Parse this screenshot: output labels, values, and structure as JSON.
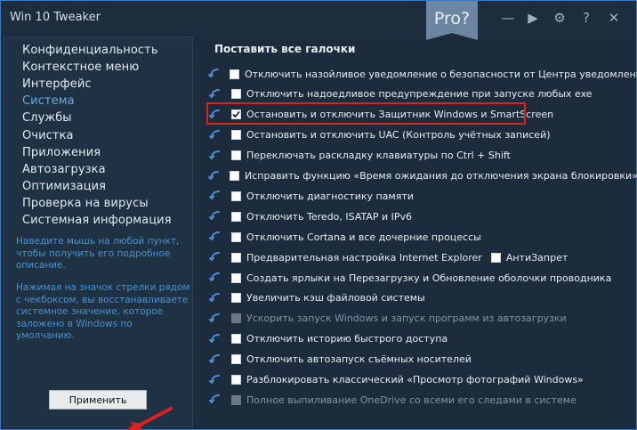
{
  "window": {
    "title": "Win 10 Tweaker",
    "pro_label": "Pro?",
    "controls": [
      "minimize-icon",
      "play-icon",
      "gear-icon",
      "help-icon",
      "close-icon"
    ],
    "control_glyphs": [
      "—",
      "▶",
      "⚙",
      "?",
      "✕"
    ]
  },
  "sidebar": {
    "items": [
      {
        "label": "Конфиденциальность",
        "active": false
      },
      {
        "label": "Контекстное меню",
        "active": false
      },
      {
        "label": "Интерфейс",
        "active": false
      },
      {
        "label": "Система",
        "active": true
      },
      {
        "label": "Службы",
        "active": false
      },
      {
        "label": "Очистка",
        "active": false
      },
      {
        "label": "Приложения",
        "active": false
      },
      {
        "label": "Автозагрузка",
        "active": false
      },
      {
        "label": "Оптимизация",
        "active": false
      },
      {
        "label": "Проверка на вирусы",
        "active": false
      },
      {
        "label": "Системная информация",
        "active": false
      }
    ],
    "hint1": "Наведите мышь на любой пункт, чтобы получить его подробное описание.",
    "hint2": "Нажимая на значок стрелки рядом с чекбоксом, вы восстанавливаете системное значение, которое заложено в Windows по умолчанию.",
    "apply_label": "Применить"
  },
  "main": {
    "header": "Поставить все галочки",
    "options": [
      {
        "label": "Отключить назойливое уведомление о безопасности от Центра уведомлений",
        "checked": false,
        "disabled": false
      },
      {
        "label": "Отключить надоедливое предупреждение при запуске любых exe",
        "checked": false,
        "disabled": false
      },
      {
        "label": "Остановить и отключить Защитник Windows и SmartScreen",
        "checked": true,
        "disabled": false,
        "highlighted": true
      },
      {
        "label": "Остановить и отключить UAC (Контроль учётных записей)",
        "checked": false,
        "disabled": false
      },
      {
        "label": "Переключать раскладку клавиатуры по Ctrl + Shift",
        "checked": false,
        "disabled": false
      },
      {
        "label": "Исправить функцию «Время ожидания до отключения экрана блокировки»",
        "checked": false,
        "disabled": false
      },
      {
        "label": "Отключить диагностику памяти",
        "checked": false,
        "disabled": false
      },
      {
        "label": "Отключить Teredo, ISATAP и IPv6",
        "checked": false,
        "disabled": false
      },
      {
        "label": "Отключить Cortana и все дочерние процессы",
        "checked": false,
        "disabled": false
      },
      {
        "label": "Предварительная настройка Internet Explorer",
        "checked": false,
        "disabled": false,
        "extra": "АнтиЗапрет"
      },
      {
        "label": "Создать ярлыки на Перезагрузку и Обновление оболочки проводника",
        "checked": false,
        "disabled": false
      },
      {
        "label": "Увеличить кэш файловой системы",
        "checked": false,
        "disabled": false
      },
      {
        "label": "Ускорить запуск Windows и запуск программ из автозагрузки",
        "checked": false,
        "disabled": true
      },
      {
        "label": "Отключить историю быстрого доступа",
        "checked": false,
        "disabled": false
      },
      {
        "label": "Отключить автозапуск съёмных носителей",
        "checked": false,
        "disabled": false
      },
      {
        "label": "Разблокировать классический «Просмотр фотографий Windows»",
        "checked": false,
        "disabled": false
      },
      {
        "label": "Полное выпиливание OneDrive со всеми его следами в системе",
        "checked": false,
        "disabled": true
      }
    ]
  },
  "colors": {
    "accent": "#3a7bc8",
    "active_nav": "#6aa7e0",
    "hint": "#4a90d0",
    "highlight": "#e02020"
  }
}
